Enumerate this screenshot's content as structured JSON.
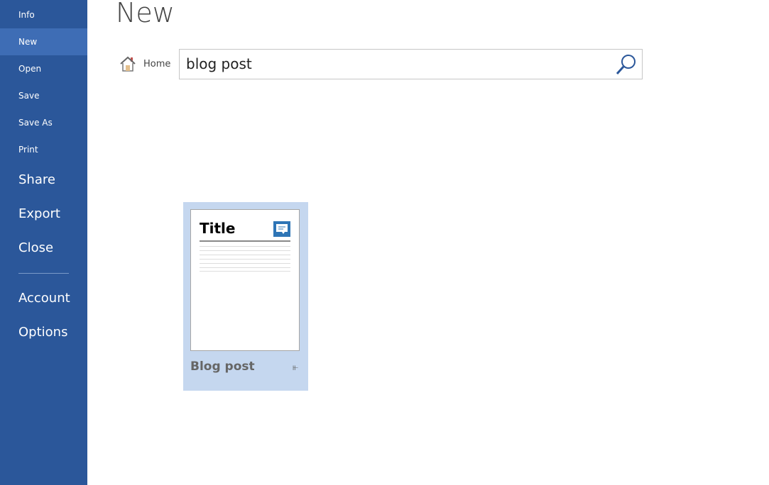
{
  "sidebar": {
    "items": [
      {
        "label": "Info",
        "selected": false
      },
      {
        "label": "New",
        "selected": true
      },
      {
        "label": "Open",
        "selected": false
      },
      {
        "label": "Save",
        "selected": false
      },
      {
        "label": "Save As",
        "selected": false
      },
      {
        "label": "Print",
        "selected": false
      }
    ],
    "big_items": [
      {
        "label": "Share"
      },
      {
        "label": "Export"
      },
      {
        "label": "Close"
      },
      {
        "label": "Account"
      },
      {
        "label": "Options"
      }
    ]
  },
  "main": {
    "title": "New",
    "home_label": "Home",
    "search": {
      "value": "blog post",
      "icon": "search-icon"
    },
    "templates": [
      {
        "name": "Blog post",
        "preview_title": "Title",
        "pin_icon": "pin-icon"
      }
    ]
  },
  "colors": {
    "sidebar": "#2b579a",
    "sidebar_selected": "#3e6db5",
    "card_selected": "#c5d7ef"
  }
}
